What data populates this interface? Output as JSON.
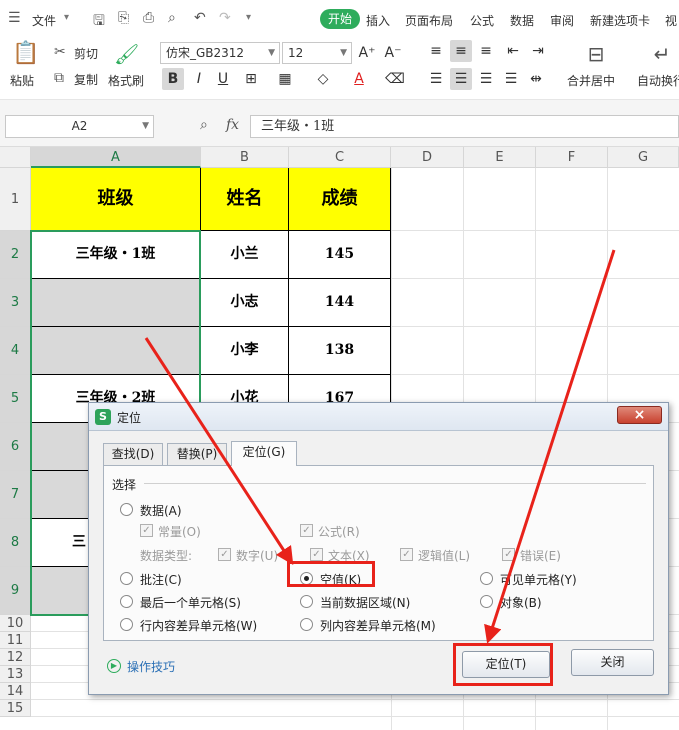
{
  "menubar": {
    "file": "文件",
    "tabs": [
      "开始",
      "插入",
      "页面布局",
      "公式",
      "数据",
      "审阅",
      "新建选项卡",
      "视"
    ]
  },
  "ribbon": {
    "paste": "粘贴",
    "cut": "剪切",
    "copy": "复制",
    "format_painter": "格式刷",
    "font_name": "仿宋_GB2312",
    "font_size": "12",
    "merge_center": "合并居中",
    "auto_wrap": "自动换行"
  },
  "formula_bar": {
    "name_box": "A2",
    "fx": "fx",
    "content": "三年级・1班"
  },
  "grid": {
    "columns": [
      "A",
      "B",
      "C",
      "D",
      "E",
      "F",
      "G"
    ],
    "rows": [
      "1",
      "2",
      "3",
      "4",
      "5",
      "6",
      "7",
      "8",
      "9",
      "10",
      "11",
      "12",
      "13",
      "14",
      "15"
    ],
    "header": [
      "班级",
      "姓名",
      "成绩"
    ],
    "data": [
      {
        "cls": "三年级・1班",
        "name": "小兰",
        "score": "145"
      },
      {
        "cls": "",
        "name": "小志",
        "score": "144"
      },
      {
        "cls": "",
        "name": "小李",
        "score": "138"
      },
      {
        "cls": "三年级・2班",
        "name": "小花",
        "score": "167"
      }
    ],
    "row8_partial": "三"
  },
  "dialog": {
    "title": "定位",
    "tabs": [
      "查找(D)",
      "替换(P)",
      "定位(G)"
    ],
    "group_label": "选择",
    "options": {
      "data": "数据(A)",
      "constant": "常量(O)",
      "formula": "公式(R)",
      "data_type_label": "数据类型:",
      "number": "数字(U)",
      "text": "文本(X)",
      "logical": "逻辑值(L)",
      "error": "错误(E)",
      "comment": "批注(C)",
      "blank": "空值(K)",
      "visible": "可见单元格(Y)",
      "last_cell": "最后一个单元格(S)",
      "current_region": "当前数据区域(N)",
      "objects": "对象(B)",
      "row_diff": "行内容差异单元格(W)",
      "col_diff": "列内容差异单元格(M)"
    },
    "tips": "操作技巧",
    "ok": "定位(T)",
    "close": "关闭"
  },
  "colors": {
    "accent": "#2eac5c",
    "header_fill": "#ffff00",
    "highlight": "#e8221a"
  }
}
